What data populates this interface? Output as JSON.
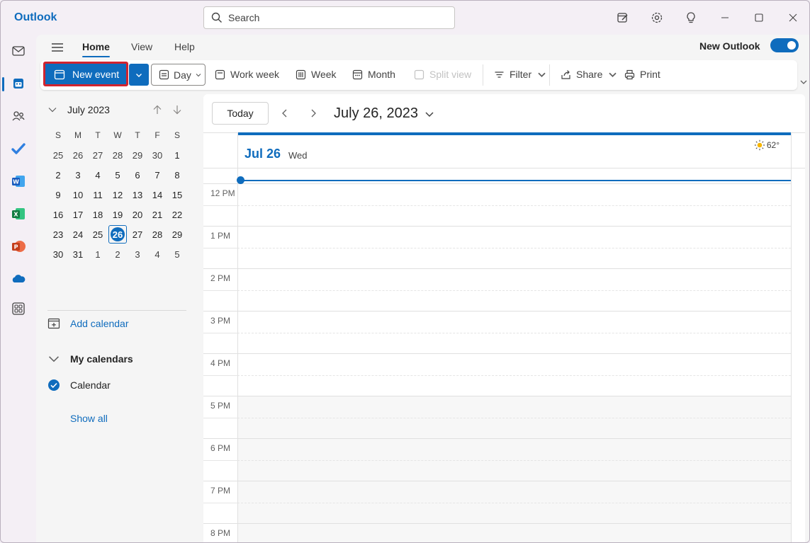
{
  "app": {
    "title": "Outlook"
  },
  "search": {
    "placeholder": "Search"
  },
  "titlebar_icons": [
    "my-day-icon",
    "settings-icon",
    "tips-icon",
    "minimize-icon",
    "maximize-icon",
    "close-icon"
  ],
  "rail": [
    "mail-icon",
    "calendar-icon",
    "people-icon",
    "to-do-icon",
    "word-icon",
    "excel-icon",
    "powerpoint-icon",
    "onedrive-icon",
    "more-apps-icon"
  ],
  "menu": {
    "tabs": [
      {
        "label": "Home",
        "active": true
      },
      {
        "label": "View",
        "active": false
      },
      {
        "label": "Help",
        "active": false
      }
    ],
    "new_outlook_label": "New Outlook",
    "new_outlook_on": true
  },
  "ribbon": {
    "new_event": "New event",
    "day": "Day",
    "work_week": "Work week",
    "week": "Week",
    "month": "Month",
    "split_view": "Split view",
    "filter": "Filter",
    "share": "Share",
    "print": "Print"
  },
  "mini_calendar": {
    "month_label": "July 2023",
    "weekdays": [
      "S",
      "M",
      "T",
      "W",
      "T",
      "F",
      "S"
    ],
    "weeks": [
      [
        "25",
        "26",
        "27",
        "28",
        "29",
        "30",
        "1"
      ],
      [
        "2",
        "3",
        "4",
        "5",
        "6",
        "7",
        "8"
      ],
      [
        "9",
        "10",
        "11",
        "12",
        "13",
        "14",
        "15"
      ],
      [
        "16",
        "17",
        "18",
        "19",
        "20",
        "21",
        "22"
      ],
      [
        "23",
        "24",
        "25",
        "26",
        "27",
        "28",
        "29"
      ],
      [
        "30",
        "31",
        "1",
        "2",
        "3",
        "4",
        "5"
      ]
    ],
    "selected": "26"
  },
  "left_pane": {
    "add_calendar": "Add calendar",
    "my_calendars": "My calendars",
    "calendar_item": "Calendar",
    "show_all": "Show all"
  },
  "day_view": {
    "today_button": "Today",
    "date_title": "July 26, 2023",
    "header_date": "Jul 26",
    "header_weekday": "Wed",
    "weather_temp": "62°",
    "hours": [
      "12 PM",
      "1 PM",
      "2 PM",
      "3 PM",
      "4 PM",
      "5 PM",
      "6 PM",
      "7 PM",
      "8 PM"
    ]
  },
  "colors": {
    "accent": "#0f6cbd",
    "highlight_border": "#d1242f"
  }
}
